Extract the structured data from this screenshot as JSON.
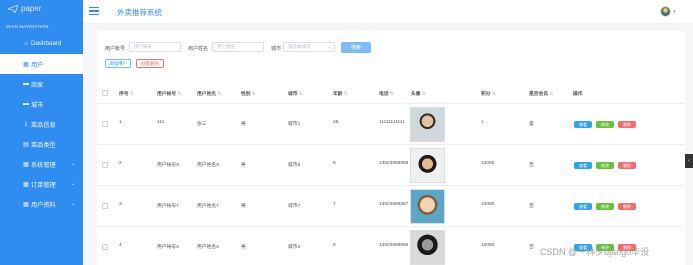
{
  "sidebar": {
    "logo_text": "paper",
    "section_label": "MAIN NAVIGATION",
    "items": [
      {
        "label": "Dashboard",
        "icon": "home-icon",
        "glyph": "⌂",
        "active": false,
        "expandable": false
      },
      {
        "label": "用户",
        "icon": "grid-icon",
        "glyph": "▦",
        "active": true,
        "expandable": false
      },
      {
        "label": "商家",
        "icon": "store-icon",
        "glyph": "▬",
        "active": false,
        "expandable": false
      },
      {
        "label": "城市",
        "icon": "city-icon",
        "glyph": "▬",
        "active": false,
        "expandable": false
      },
      {
        "label": "菜品信息",
        "icon": "download-icon",
        "glyph": "⤓",
        "active": false,
        "expandable": false
      },
      {
        "label": "菜品类型",
        "icon": "list-icon",
        "glyph": "▤",
        "active": false,
        "expandable": false
      },
      {
        "label": "系统管理",
        "icon": "grid-icon",
        "glyph": "▦",
        "active": false,
        "expandable": true
      },
      {
        "label": "订单管理",
        "icon": "grid-icon",
        "glyph": "▦",
        "active": false,
        "expandable": true
      },
      {
        "label": "用户资料",
        "icon": "grid-icon",
        "glyph": "▦",
        "active": false,
        "expandable": true
      }
    ]
  },
  "header": {
    "title": "外卖推荐系统"
  },
  "filters": {
    "account_label": "用户帐号",
    "account_placeholder": "用户帐号",
    "name_label": "用户姓名",
    "name_placeholder": "用户姓名",
    "city_label": "城市",
    "city_placeholder": "请选择城市",
    "search_label": "搜索",
    "add_label": "添加用户",
    "batch_delete_label": "批量删除"
  },
  "table": {
    "headers": [
      "序号",
      "用户帐号",
      "用户姓名",
      "性别",
      "城市",
      "年龄",
      "电话",
      "头像",
      "积分",
      "是否会员",
      "操作"
    ],
    "rows": [
      {
        "index": "1",
        "account": "111",
        "name": "张三",
        "gender": "男",
        "city": "城市1",
        "age": "25",
        "phone": "11111111111",
        "points": "1",
        "vip": "是",
        "avatar": "portrait-young-man"
      },
      {
        "index": "2",
        "account": "用户帐号8",
        "name": "用户姓名8",
        "gender": "男",
        "city": "城市8",
        "age": "8",
        "phone": "13823888888",
        "points": "10000",
        "vip": "否",
        "avatar": "portrait-man-dark-hair"
      },
      {
        "index": "3",
        "account": "用户帐号7",
        "name": "用户姓名7",
        "gender": "男",
        "city": "城市7",
        "age": "7",
        "phone": "13823888887",
        "points": "10000",
        "vip": "否",
        "avatar": "portrait-cartoon-doll"
      },
      {
        "index": "4",
        "account": "用户帐号6",
        "name": "用户姓名6",
        "gender": "男",
        "city": "城市6",
        "age": "6",
        "phone": "13823888886",
        "points": "10000",
        "vip": "否",
        "avatar": "portrait-man-black-white"
      }
    ],
    "actions": {
      "view": "查看",
      "edit": "修改",
      "delete": "删除"
    }
  },
  "colors": {
    "primary": "#2f8cf0",
    "danger": "#f56c6c",
    "success": "#67c23a",
    "info": "#2fa4e7"
  },
  "watermark": "CSDN @一林夕django毕设"
}
